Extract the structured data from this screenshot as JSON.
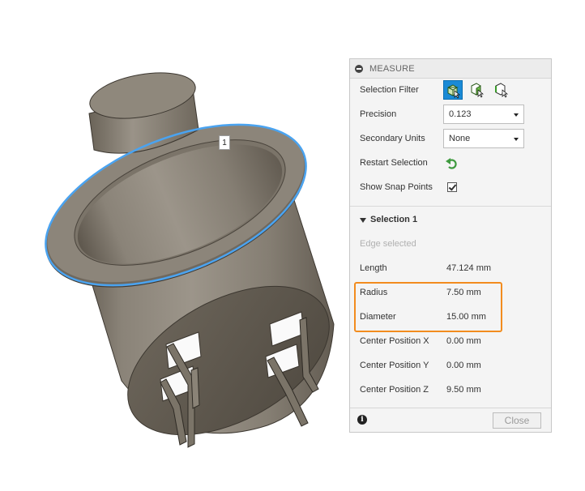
{
  "viewport": {
    "selection_marker": "1"
  },
  "measure_panel": {
    "title": "MEASURE",
    "selection_filter_label": "Selection Filter",
    "selection_filter_icons": [
      "body-filter-icon",
      "face-filter-icon",
      "edge-filter-icon"
    ],
    "precision": {
      "label": "Precision",
      "value": "0.123"
    },
    "secondary_units": {
      "label": "Secondary Units",
      "value": "None"
    },
    "restart_selection_label": "Restart Selection",
    "show_snap_points": {
      "label": "Show Snap Points",
      "checked": true
    },
    "selection_section": {
      "title": "Selection 1",
      "status": "Edge selected",
      "rows": [
        {
          "label": "Length",
          "value": "47.124 mm"
        },
        {
          "label": "Radius",
          "value": "7.50 mm"
        },
        {
          "label": "Diameter",
          "value": "15.00 mm"
        },
        {
          "label": "Center Position X",
          "value": "0.00 mm"
        },
        {
          "label": "Center Position Y",
          "value": "0.00 mm"
        },
        {
          "label": "Center Position Z",
          "value": "9.50 mm"
        }
      ]
    },
    "close_label": "Close"
  },
  "colors": {
    "accent": "#1a8ad6",
    "selection_edge": "#4aa3f0",
    "highlight_box": "#f28c1e",
    "green_restart": "#3f9a3f"
  }
}
